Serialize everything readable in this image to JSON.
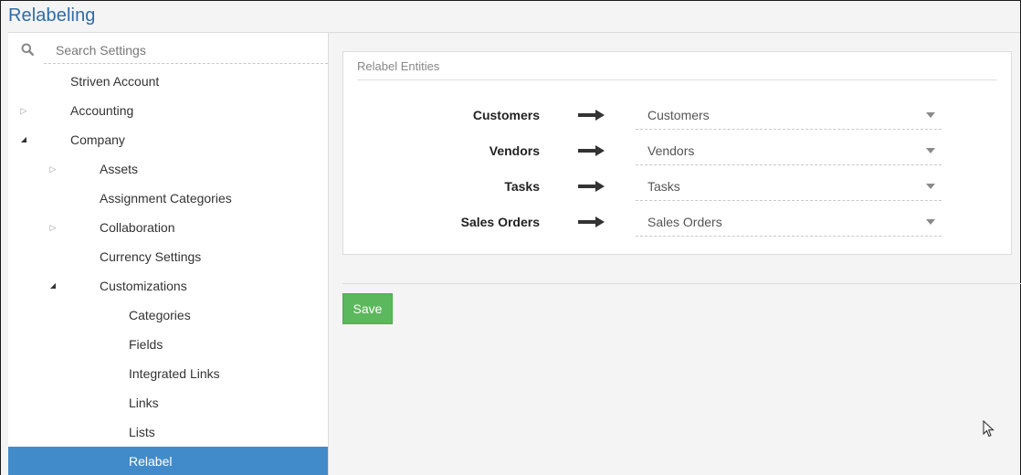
{
  "page": {
    "title": "Relabeling"
  },
  "sidebar": {
    "search": {
      "placeholder": "Search Settings",
      "value": "",
      "icon": "search-icon"
    },
    "items": [
      {
        "label": "Striven Account",
        "level": 0,
        "toggle": "none",
        "selected": false
      },
      {
        "label": "Accounting",
        "level": 0,
        "toggle": "collapsed",
        "selected": false
      },
      {
        "label": "Company",
        "level": 0,
        "toggle": "expanded",
        "selected": false
      },
      {
        "label": "Assets",
        "level": 1,
        "toggle": "collapsed",
        "selected": false
      },
      {
        "label": "Assignment Categories",
        "level": 1,
        "toggle": "none",
        "selected": false
      },
      {
        "label": "Collaboration",
        "level": 1,
        "toggle": "collapsed",
        "selected": false
      },
      {
        "label": "Currency Settings",
        "level": 1,
        "toggle": "none",
        "selected": false
      },
      {
        "label": "Customizations",
        "level": 1,
        "toggle": "expanded",
        "selected": false
      },
      {
        "label": "Categories",
        "level": 2,
        "toggle": "none",
        "selected": false
      },
      {
        "label": "Fields",
        "level": 2,
        "toggle": "none",
        "selected": false
      },
      {
        "label": "Integrated Links",
        "level": 2,
        "toggle": "none",
        "selected": false
      },
      {
        "label": "Links",
        "level": 2,
        "toggle": "none",
        "selected": false
      },
      {
        "label": "Lists",
        "level": 2,
        "toggle": "none",
        "selected": false
      },
      {
        "label": "Relabel",
        "level": 2,
        "toggle": "none",
        "selected": true
      }
    ]
  },
  "main": {
    "panel_title": "Relabel Entities",
    "rows": [
      {
        "entity": "Customers",
        "value": "Customers"
      },
      {
        "entity": "Vendors",
        "value": "Vendors"
      },
      {
        "entity": "Tasks",
        "value": "Tasks"
      },
      {
        "entity": "Sales Orders",
        "value": "Sales Orders"
      }
    ],
    "save_label": "Save"
  },
  "colors": {
    "title": "#2f6ba9",
    "selected_bg": "#428bca",
    "save_bg": "#5cb85c"
  }
}
